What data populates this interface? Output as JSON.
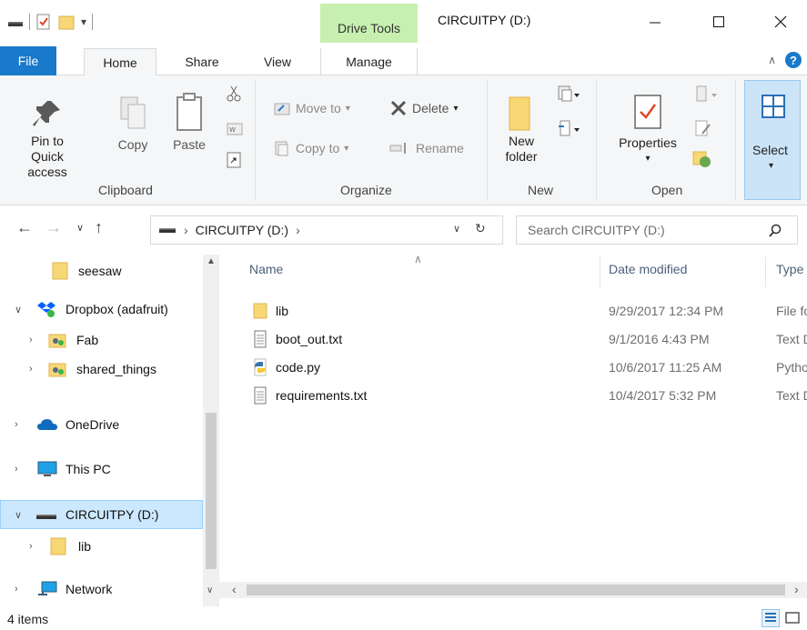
{
  "titlebar": {
    "contextual_tab": "Drive Tools",
    "title": "CIRCUITPY (D:)"
  },
  "tabs": {
    "file": "File",
    "home": "Home",
    "share": "Share",
    "view": "View",
    "manage": "Manage"
  },
  "ribbon": {
    "clipboard": {
      "label": "Clipboard",
      "pin_line1": "Pin to Quick",
      "pin_line2": "access",
      "copy": "Copy",
      "paste": "Paste"
    },
    "organize": {
      "label": "Organize",
      "move_to": "Move to",
      "copy_to": "Copy to",
      "delete": "Delete",
      "rename": "Rename"
    },
    "new": {
      "label": "New",
      "folder_line1": "New",
      "folder_line2": "folder"
    },
    "open": {
      "label": "Open",
      "properties": "Properties"
    },
    "select": {
      "label": "Select"
    }
  },
  "address": {
    "path": "CIRCUITPY (D:)",
    "search_placeholder": "Search CIRCUITPY (D:)"
  },
  "nav_pane": [
    {
      "label": "seesaw"
    },
    {
      "label": "Dropbox (adafruit)"
    },
    {
      "label": "Fab"
    },
    {
      "label": "shared_things"
    },
    {
      "label": "OneDrive"
    },
    {
      "label": "This PC"
    },
    {
      "label": "CIRCUITPY (D:)"
    },
    {
      "label": "lib"
    },
    {
      "label": "Network"
    }
  ],
  "columns": {
    "name": "Name",
    "date": "Date modified",
    "type": "Type"
  },
  "files": [
    {
      "name": "lib",
      "date": "9/29/2017 12:34 PM",
      "type": "File folder",
      "icon": "folder-icon"
    },
    {
      "name": "boot_out.txt",
      "date": "9/1/2016 4:43 PM",
      "type": "Text Document",
      "icon": "text-file-icon"
    },
    {
      "name": "code.py",
      "date": "10/6/2017 11:25 AM",
      "type": "Python File",
      "icon": "python-file-icon"
    },
    {
      "name": "requirements.txt",
      "date": "10/4/2017 5:32 PM",
      "type": "Text Document",
      "icon": "text-file-icon"
    }
  ],
  "status": {
    "item_count": "4 items"
  },
  "colors": {
    "file_tab": "#1979ca",
    "drive_tools": "#c7f0b0",
    "selection": "#cce8ff"
  }
}
